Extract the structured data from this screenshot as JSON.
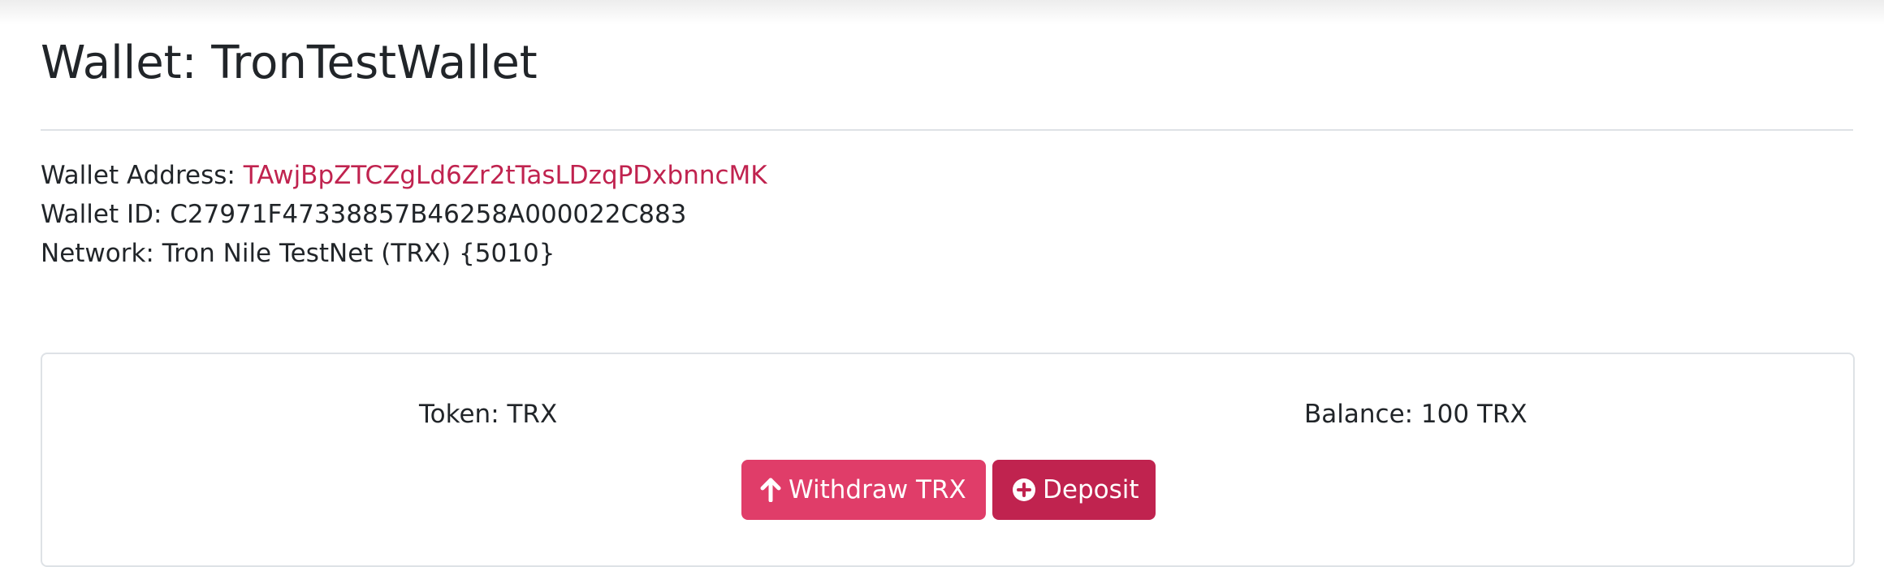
{
  "header": {
    "title": "Wallet: TronTestWallet"
  },
  "wallet": {
    "address_label": "Wallet Address: ",
    "address": "TAwjBpZTCZgLd6Zr2tTasLDzqPDxbnncMK",
    "id_line": "Wallet ID: C27971F47338857B46258A000022C883",
    "network_line": "Network: Tron Nile TestNet (TRX) {5010}"
  },
  "token_card": {
    "token_line": "Token: TRX",
    "balance_line": "Balance: 100 TRX",
    "withdraw_label": "Withdraw TRX",
    "withdraw_icon": "arrow-up-icon",
    "deposit_label": "Deposit",
    "deposit_icon": "plus-circle-icon"
  },
  "colors": {
    "address_link": "#c0234f",
    "withdraw_button": "#e03d69",
    "deposit_button": "#c0234f"
  }
}
